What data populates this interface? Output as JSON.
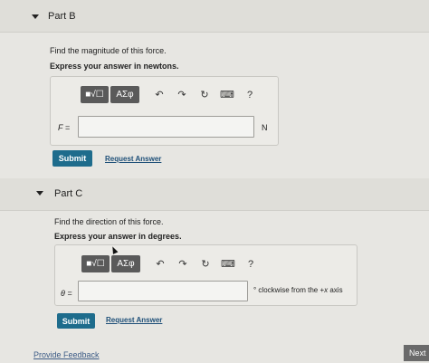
{
  "part_b": {
    "title": "Part B",
    "question": "Find the magnitude of this force.",
    "instruction": "Express your answer in newtons.",
    "toolbar": {
      "template_button": "■√☐",
      "greek_button": "ΑΣφ",
      "undo_icon": "↶",
      "redo_icon": "↷",
      "reset_icon": "↻",
      "keyboard_icon": "⌨",
      "help_label": "?"
    },
    "variable": "F =",
    "input_value": "",
    "unit": "N",
    "submit_label": "Submit",
    "request_answer_label": "Request Answer"
  },
  "part_c": {
    "title": "Part C",
    "question": "Find the direction of this force.",
    "instruction": "Express your answer in degrees.",
    "toolbar": {
      "template_button": "■√☐",
      "greek_button": "ΑΣφ",
      "undo_icon": "↶",
      "redo_icon": "↷",
      "reset_icon": "↻",
      "keyboard_icon": "⌨",
      "help_label": "?"
    },
    "variable": "θ =",
    "input_value": "",
    "unit_prefix": "° clockwise from the +",
    "unit_var": "x",
    "unit_suffix": " axis",
    "submit_label": "Submit",
    "request_answer_label": "Request Answer"
  },
  "footer": {
    "feedback_label": "Provide Feedback",
    "next_label": "Next"
  }
}
